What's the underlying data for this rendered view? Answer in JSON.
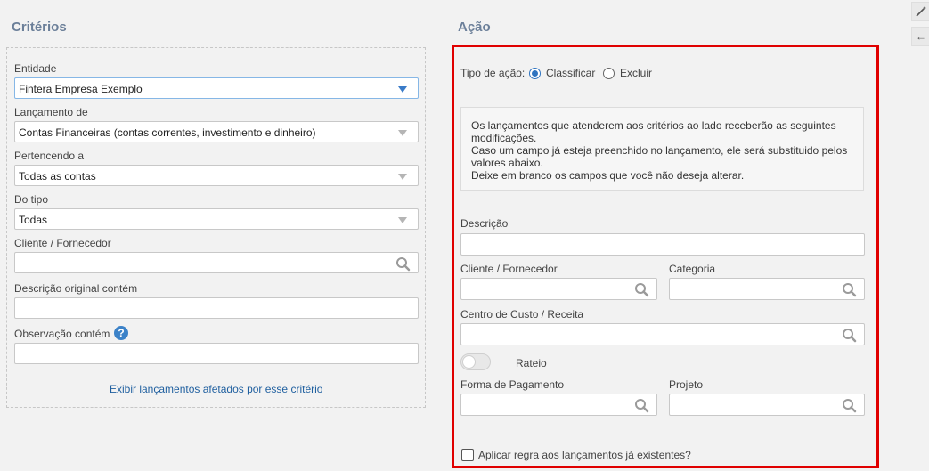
{
  "criterios": {
    "title": "Critérios",
    "entidade_label": "Entidade",
    "entidade_value": "Fintera Empresa Exemplo",
    "lancamento_label": "Lançamento de",
    "lancamento_value": "Contas Financeiras (contas correntes, investimento e dinheiro)",
    "pertencendo_label": "Pertencendo a",
    "pertencendo_value": "Todas as contas",
    "tipo_label": "Do tipo",
    "tipo_value": "Todas",
    "cliente_label": "Cliente / Fornecedor",
    "cliente_value": "",
    "descricao_label": "Descrição original contém",
    "descricao_value": "",
    "observacao_label": "Observação contém",
    "observacao_help": "?",
    "observacao_value": "",
    "link": "Exibir lançamentos afetados por esse critério"
  },
  "acao": {
    "title": "Ação",
    "tipo_label": "Tipo de ação:",
    "options": [
      "Classificar",
      "Excluir"
    ],
    "selected": "Classificar",
    "info_lines": [
      "Os lançamentos que atenderem aos critérios ao lado receberão as seguintes",
      "modificações.",
      "Caso um campo já esteja preenchido no lançamento, ele será substituido pelos",
      "valores abaixo.",
      "Deixe em branco os campos que você não deseja alterar."
    ],
    "descricao_label": "Descrição",
    "cliente_label": "Cliente / Fornecedor",
    "categoria_label": "Categoria",
    "centro_label": "Centro de Custo / Receita",
    "rateio_label": "Rateio",
    "rateio_on": false,
    "forma_label": "Forma de Pagamento",
    "projeto_label": "Projeto",
    "aplicar_label": "Aplicar regra aos lançamentos já existentes?",
    "aplicar_checked": false
  },
  "side": {
    "magic_icon": "magic-wand-icon",
    "back_icon": "arrow-left-icon",
    "back_glyph": "←"
  },
  "colors": {
    "highlight": "#e00000",
    "accent": "#2f74c0",
    "title": "#6b7f99"
  }
}
